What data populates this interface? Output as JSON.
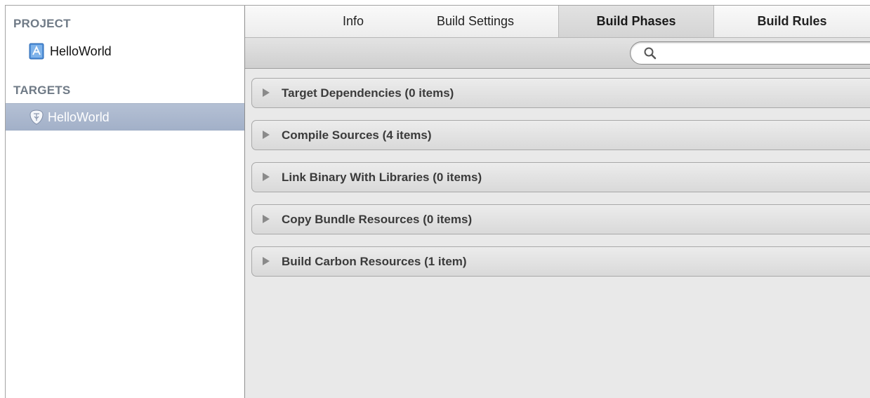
{
  "sidebar": {
    "project_header": "PROJECT",
    "project_item": "HelloWorld",
    "targets_header": "TARGETS",
    "target_item": "HelloWorld"
  },
  "tabs": {
    "info": "Info",
    "build_settings": "Build Settings",
    "build_phases": "Build Phases",
    "build_rules": "Build Rules"
  },
  "search": {
    "value": ""
  },
  "phases": [
    "Target Dependencies (0 items)",
    "Compile Sources (4 items)",
    "Link Binary With Libraries (0 items)",
    "Copy Bundle Resources (0 items)",
    "Build Carbon Resources (1 item)"
  ],
  "colors": {
    "section_header": "#6f7a86",
    "selection": "#a9b5cb",
    "panel_bg": "#e9e9e9"
  }
}
